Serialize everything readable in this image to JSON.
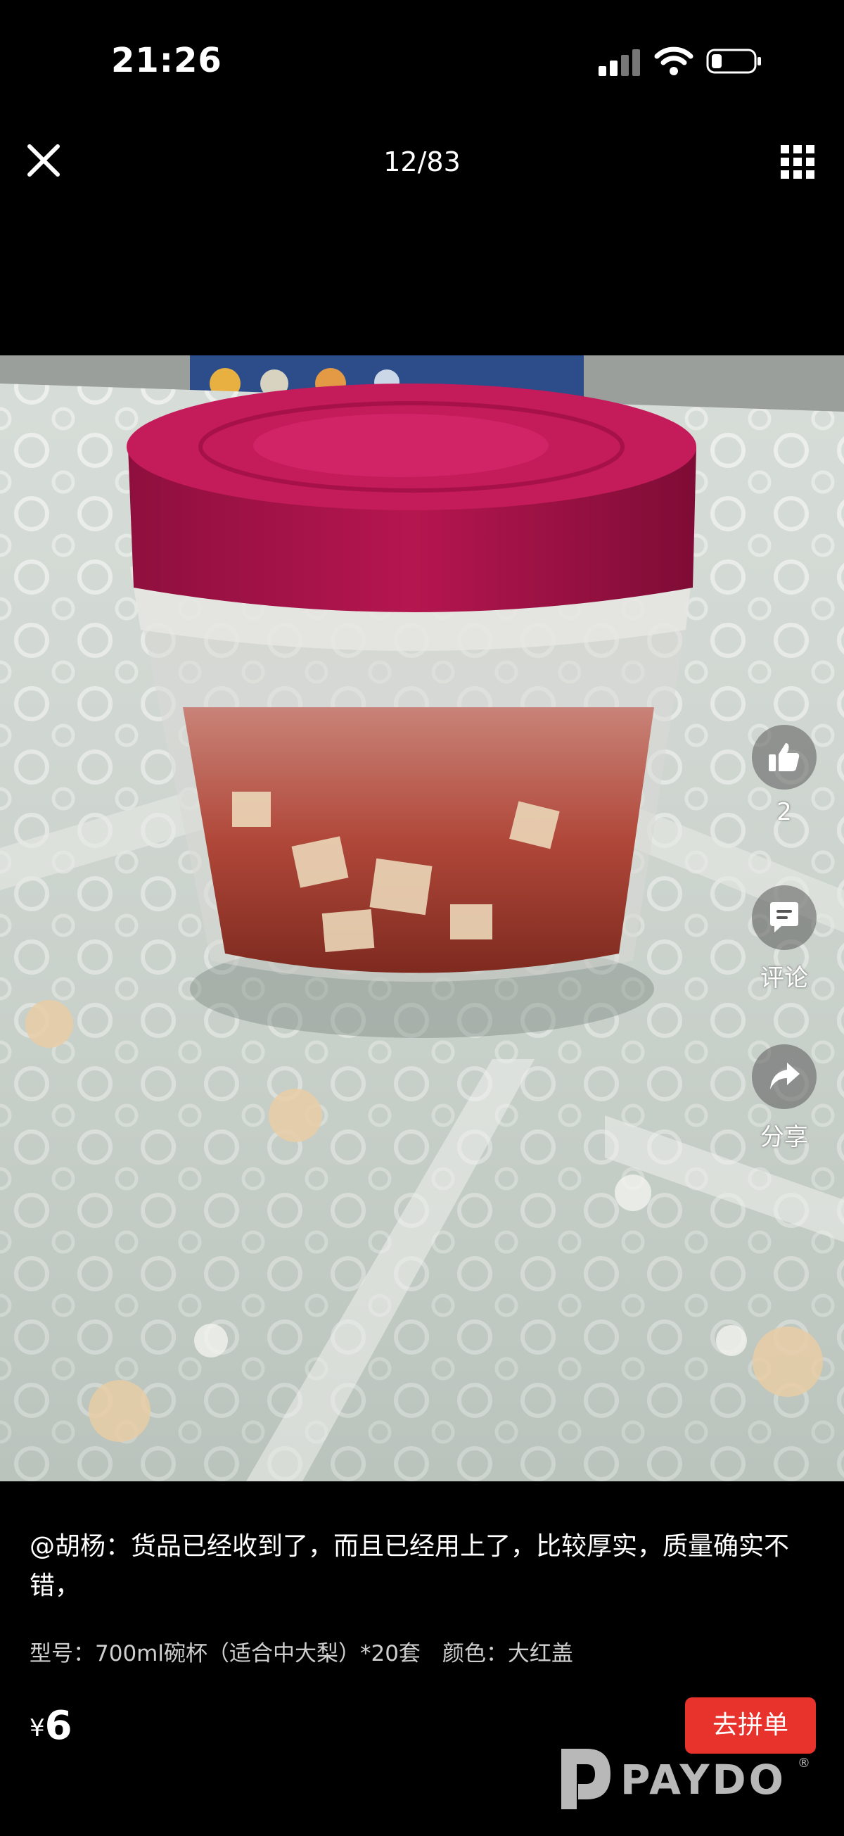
{
  "status_bar": {
    "time": "21:26"
  },
  "top_bar": {
    "page_counter": "12/83"
  },
  "actions": {
    "like_count": "2",
    "comment_label": "评论",
    "share_label": "分享"
  },
  "review": {
    "text": "@胡杨：货品已经收到了，而且已经用上了，比较厚实，质量确实不错，",
    "spec": "型号：700ml碗杯（适合中大梨）*20套　颜色：大红盖"
  },
  "footer": {
    "currency": "¥",
    "price": "6",
    "group_buy_label": "去拼单",
    "watermark": "PAYDO",
    "watermark_mark": "®"
  },
  "colors": {
    "group_buy_button": "#e8332c",
    "lid": "#b5164f"
  }
}
